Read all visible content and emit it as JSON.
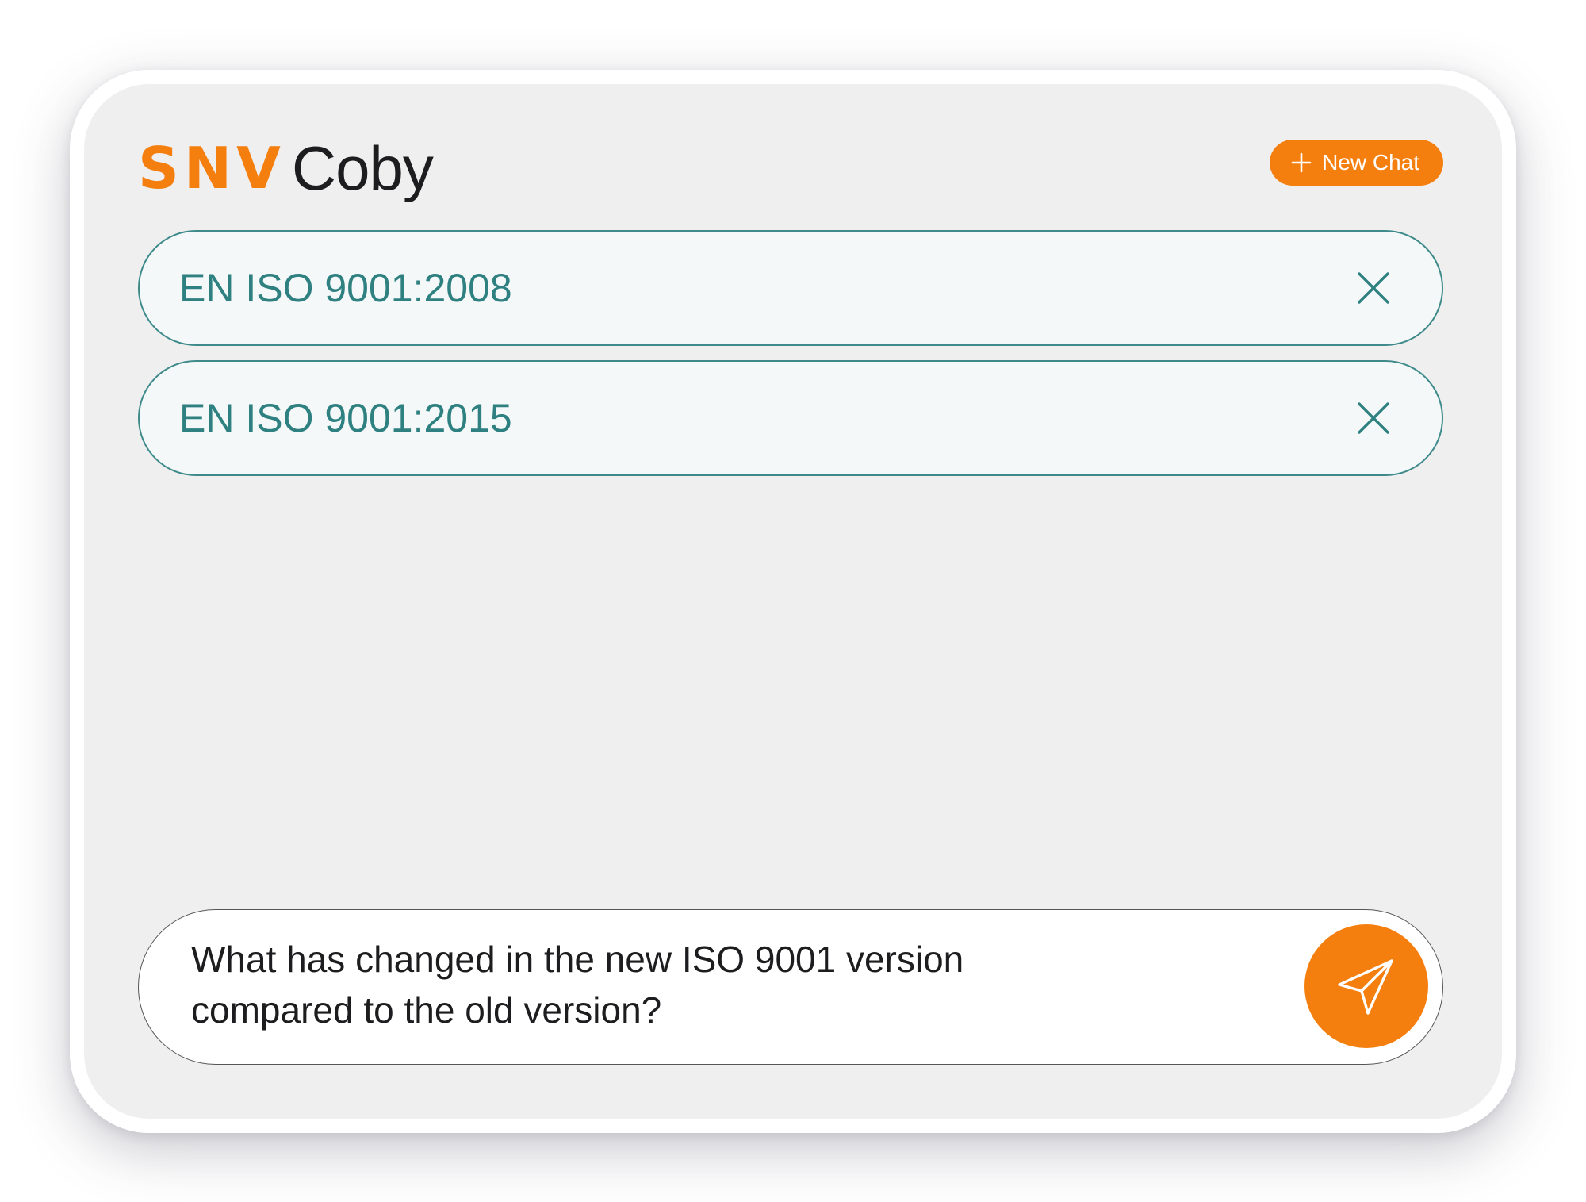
{
  "app": {
    "brand": "SNV",
    "product": "Coby"
  },
  "header": {
    "new_chat_label": "New Chat"
  },
  "documents": [
    {
      "label": "EN ISO 9001:2008"
    },
    {
      "label": "EN ISO 9001:2015"
    }
  ],
  "composer": {
    "message_line1": "What has changed in the new ISO 9001 version",
    "message_line2": "compared to the old version?"
  },
  "icons": {
    "new_chat": "plus-icon",
    "remove_document": "close-icon",
    "send": "paper-plane-icon"
  },
  "colors": {
    "accent": "#f57f0e",
    "chip_text": "#2f8080",
    "chip_border": "#3e8a8a",
    "background": "#efefef"
  }
}
